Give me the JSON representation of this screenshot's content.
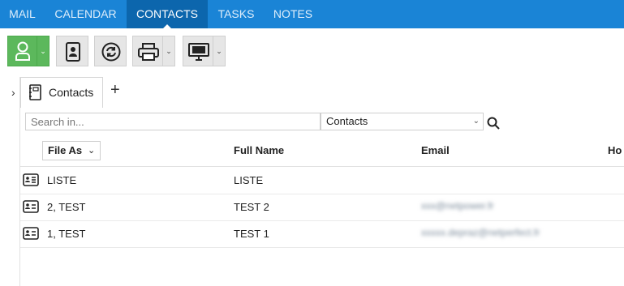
{
  "nav": {
    "tabs": [
      {
        "label": "MAIL"
      },
      {
        "label": "CALENDAR"
      },
      {
        "label": "CONTACTS"
      },
      {
        "label": "TASKS"
      },
      {
        "label": "NOTES"
      }
    ],
    "active": "CONTACTS"
  },
  "toolbar": {
    "icons": [
      "person-icon",
      "address-book-icon",
      "refresh-icon",
      "printer-icon",
      "monitor-icon"
    ],
    "accent": "#5cb85c"
  },
  "folder_tab": {
    "label": "Contacts",
    "add": "+"
  },
  "search": {
    "placeholder": "Search in...",
    "scope": "Contacts"
  },
  "table": {
    "columns": [
      "File As",
      "Full Name",
      "Email",
      "Ho"
    ],
    "rows": [
      {
        "file_as": "LISTE",
        "full_name": "LISTE",
        "email": ""
      },
      {
        "file_as": "2, TEST",
        "full_name": "TEST 2",
        "email": "xxx@netpower.fr"
      },
      {
        "file_as": "1, TEST",
        "full_name": "TEST 1",
        "email": "xxxxx.depraz@netperfect.fr"
      }
    ]
  },
  "colors": {
    "nav_bg": "#1a84d6",
    "nav_active": "#0c66ad",
    "button_green": "#5cb85c"
  }
}
